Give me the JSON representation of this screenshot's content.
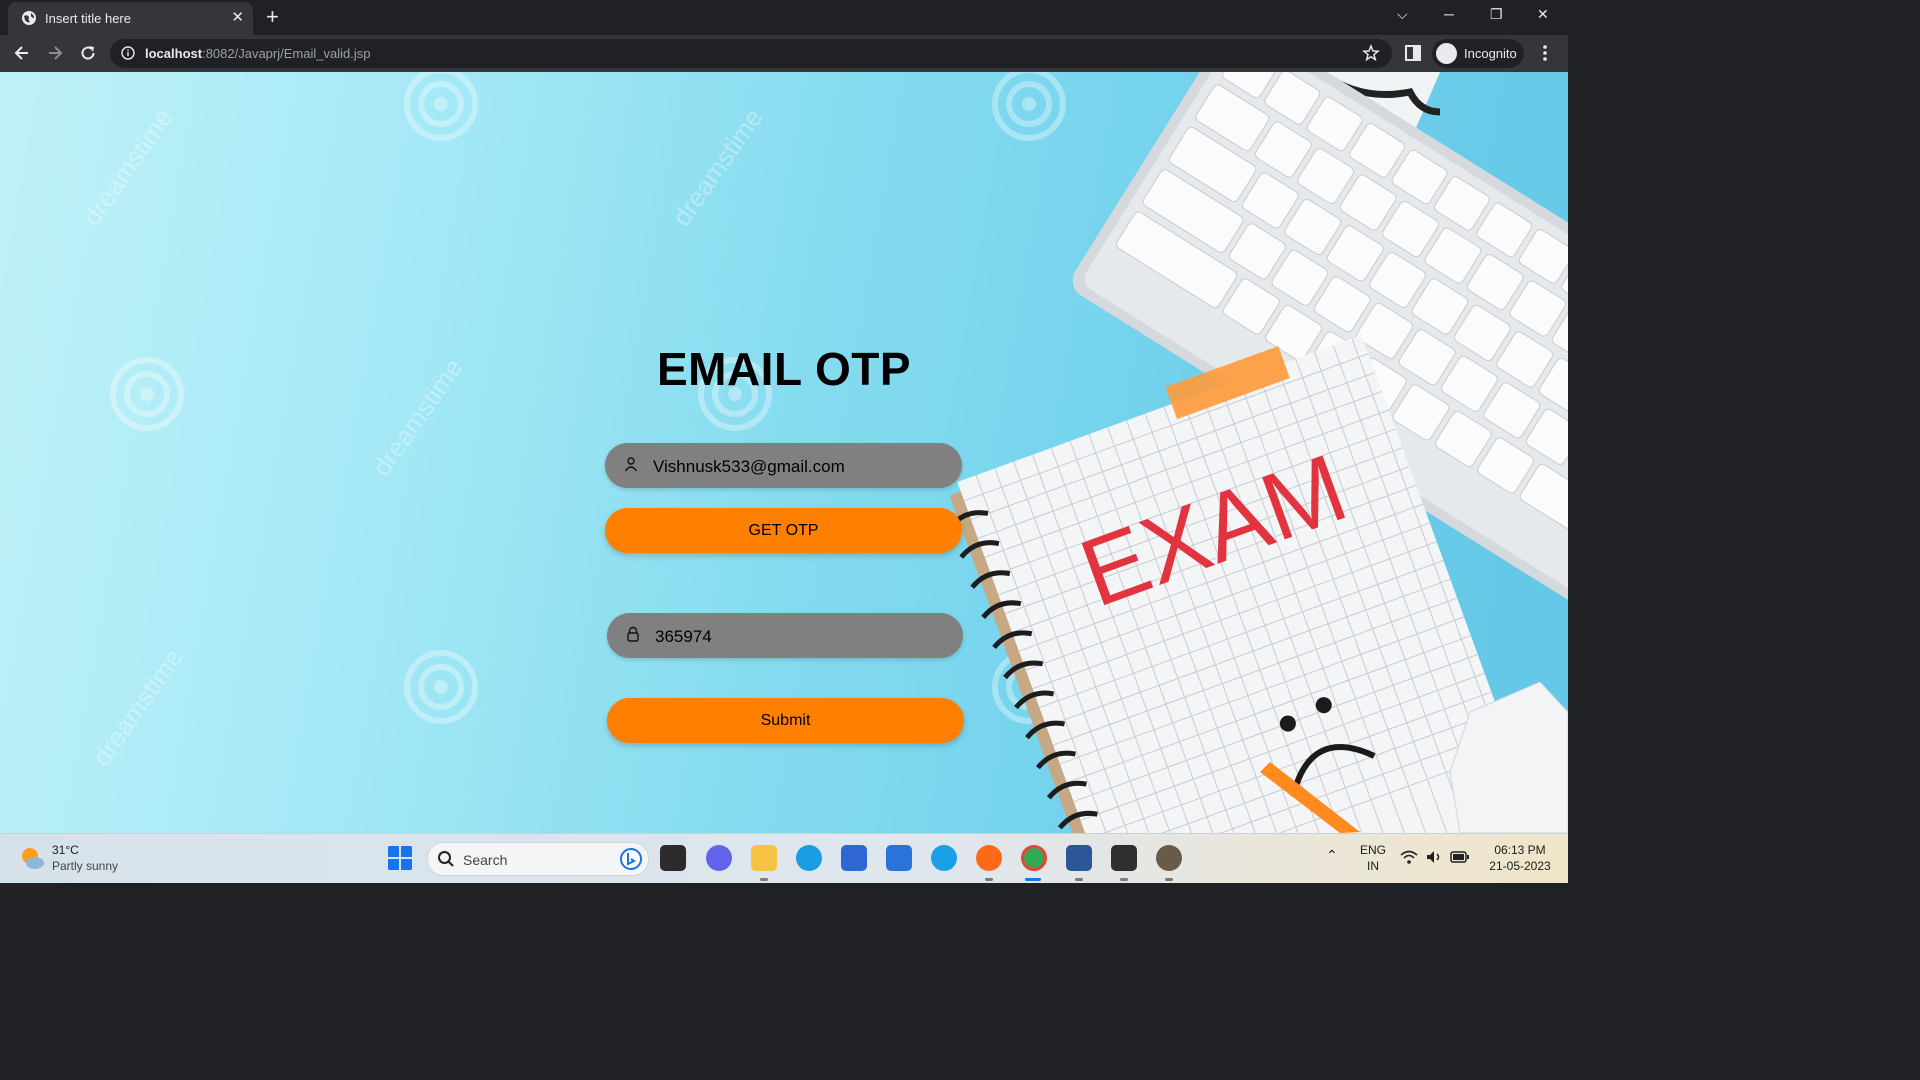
{
  "browser": {
    "tab_title": "Insert title here",
    "url_host": "localhost",
    "url_path": ":8082/Javaprj/Email_valid.jsp",
    "profile_label": "Incognito"
  },
  "form": {
    "title": "EMAIL OTP",
    "email_value": "Vishnusk533@gmail.com",
    "get_otp_label": "GET OTP",
    "otp_value": "365974",
    "submit_label": "Submit",
    "input_color": "#808080",
    "button_color": "#ff7f00"
  },
  "background": {
    "notebook_text": "EXAM",
    "watermark_text": "dreamstime"
  },
  "taskbar": {
    "temperature": "31°C",
    "weather": "Partly sunny",
    "search_label": "Search",
    "language": "ENG",
    "region": "IN",
    "time": "06:13 PM",
    "date": "21-05-2023"
  }
}
